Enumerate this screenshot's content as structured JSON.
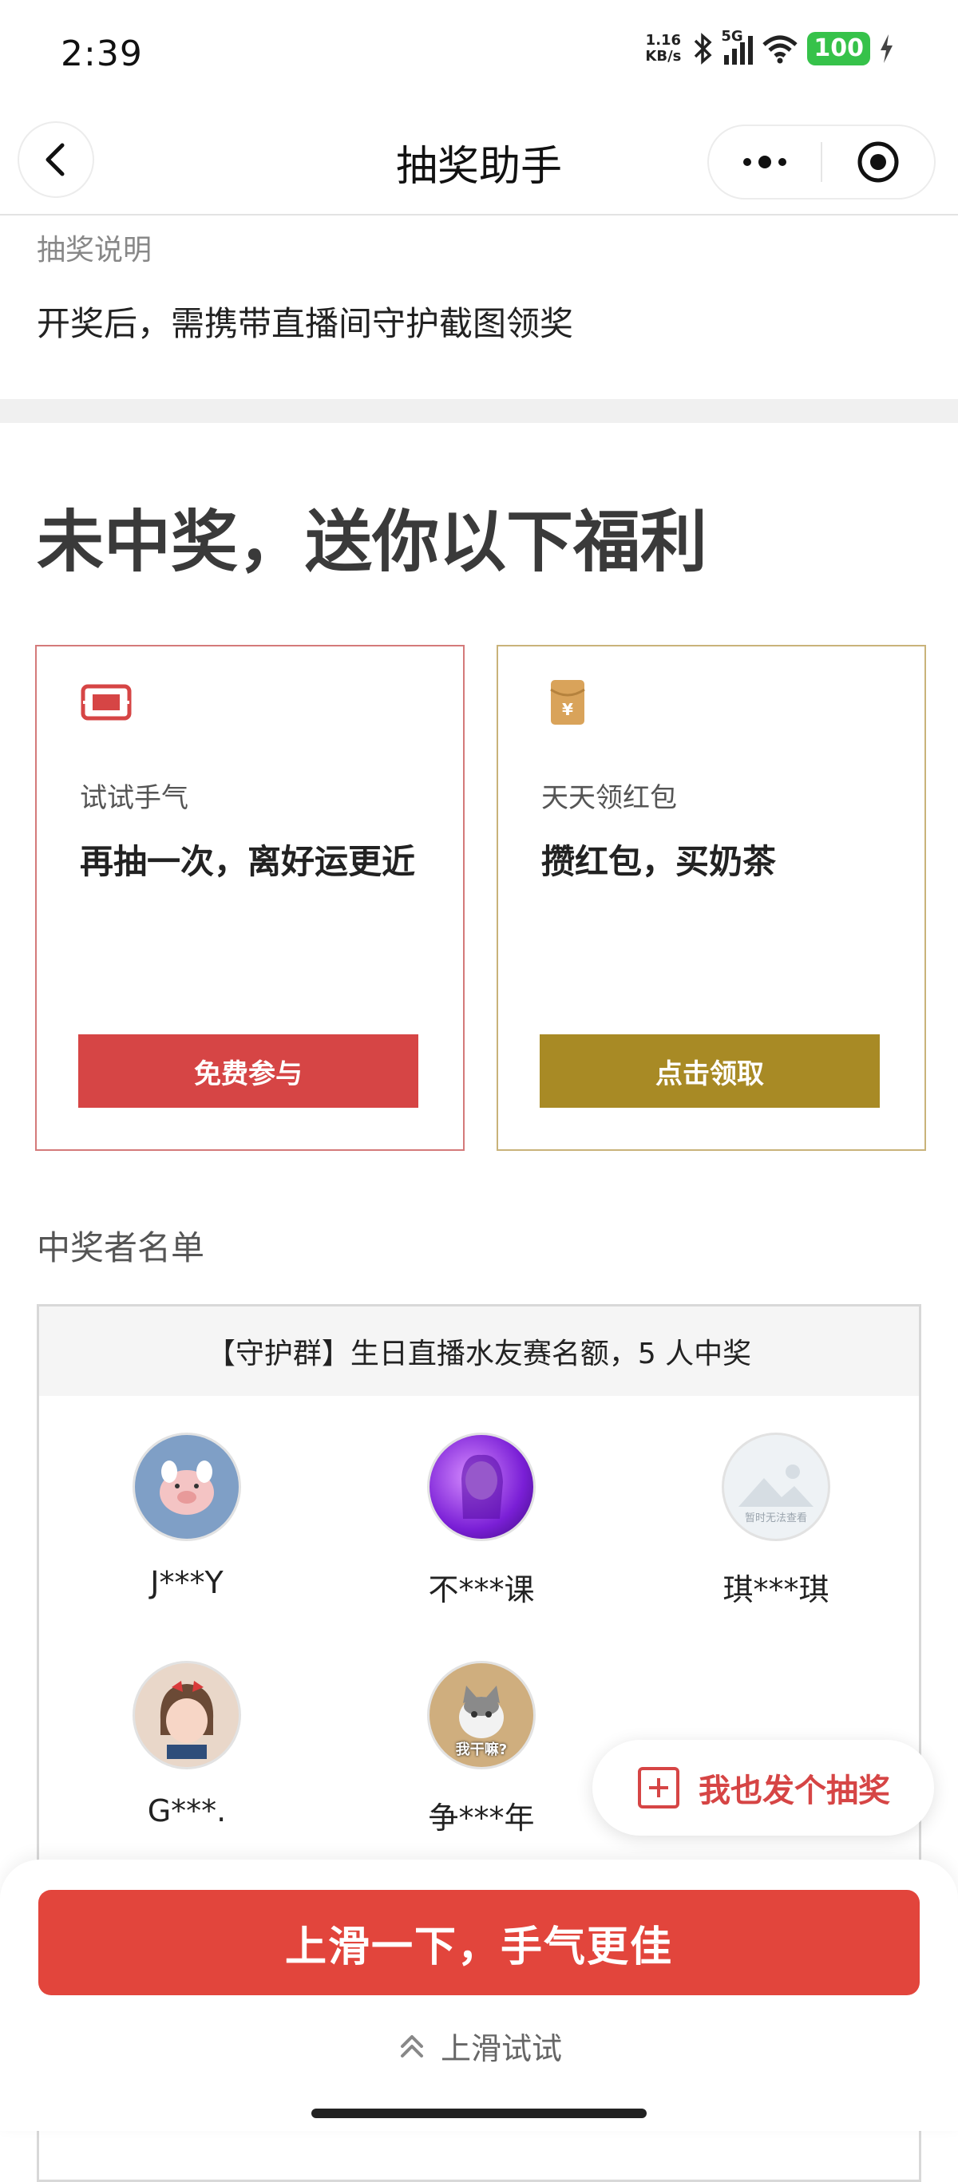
{
  "status_bar": {
    "time": "2:39",
    "speed_value": "1.16",
    "speed_unit": "KB/s",
    "network": "5G",
    "battery": "100"
  },
  "nav": {
    "title": "抽奖助手",
    "back_icon": "chevron-left-icon",
    "more_icon": "more-dots-icon",
    "close_icon": "target-close-icon"
  },
  "description": {
    "label": "抽奖说明",
    "text": "开奖后，需携带直播间守护截图领奖"
  },
  "welfare": {
    "title": "未中奖，送你以下福利",
    "cards": [
      {
        "icon": "ticket-icon",
        "subtitle": "试试手气",
        "headline": "再抽一次，离好运更近",
        "button": "免费参与",
        "accent": "#d64545"
      },
      {
        "icon": "red-envelope-icon",
        "subtitle": "天天领红包",
        "headline": "攒红包，买奶茶",
        "button": "点击领取",
        "accent": "#a88a25"
      }
    ]
  },
  "winners": {
    "label": "中奖者名单",
    "group_title": "【守护群】生日直播水友赛名额，5 人中奖",
    "list": [
      {
        "name": "J***Y",
        "avatar": "pig-avatar"
      },
      {
        "name": "不***课",
        "avatar": "purple-portrait-avatar"
      },
      {
        "name": "琪***琪",
        "avatar": "placeholder-avatar",
        "avatar_text": "暂时无法查看"
      },
      {
        "name": "G***.",
        "avatar": "girl-avatar"
      },
      {
        "name": "争***年",
        "avatar": "kitten-avatar",
        "avatar_text": "我干嘛?"
      }
    ]
  },
  "float_button": {
    "label": "我也发个抽奖",
    "icon": "plus-square-icon"
  },
  "bottom": {
    "primary": "上滑一下，手气更佳",
    "hint": "上滑试试",
    "hint_icon": "double-chevron-up-icon"
  },
  "colors": {
    "primary_red": "#e2453c",
    "gold": "#a88a25",
    "battery_green": "#36c24a"
  }
}
